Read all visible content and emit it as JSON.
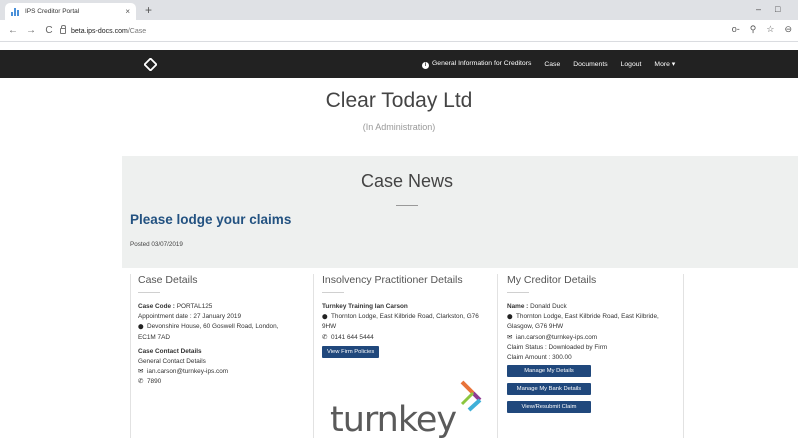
{
  "browser": {
    "tab_title": "IPS Creditor Portal",
    "tab_close": "×",
    "new_tab": "+",
    "url_host": "beta.ips-docs.com",
    "url_path": "/Case",
    "minimize": "–",
    "restore": "□",
    "back": "←",
    "forward": "→",
    "reload": "C",
    "key_icon": "o-",
    "zoom_icon": "⚲",
    "star_icon": "☆",
    "account_icon": "⊖"
  },
  "site_nav": {
    "info_label": "i",
    "general_info": "General Information for Creditors",
    "case": "Case",
    "documents": "Documents",
    "logout": "Logout",
    "more": "More ▾"
  },
  "hero": {
    "company": "Clear Today Ltd",
    "status": "(In Administration)"
  },
  "news": {
    "title": "Case News",
    "headline": "Please lodge your claims",
    "posted": "Posted 03/07/2019"
  },
  "case_details": {
    "title": "Case Details",
    "code_label": "Case Code :",
    "code_value": "PORTAL125",
    "appointment": "Appointment date : 27 January 2019",
    "address_line1": "Devonshire House, 60 Goswell Road, London,",
    "address_line2": "EC1M 7AD",
    "contact_heading": "Case Contact Details",
    "contact_general": "General Contact Details",
    "contact_email": "ian.carson@turnkey-ips.com",
    "contact_phone": "7890"
  },
  "ip_details": {
    "title": "Insolvency Practitioner Details",
    "name": "Turnkey Training Ian Carson",
    "address_line1": "Thornton Lodge, East Kilbride Road, Clarkston, G76",
    "address_line2": "9HW",
    "phone": "0141 644 5444",
    "button": "View Firm Policies",
    "logo_text": "turnkey"
  },
  "creditor_details": {
    "title": "My Creditor Details",
    "name_label": "Name :",
    "name_value": "Donald Duck",
    "address_line1": "Thornton Lodge, East Kilbride Road, East Kilbride,",
    "address_line2": "Glasgow, G76 9HW",
    "email": "ian.carson@turnkey-ips.com",
    "claim_status": "Claim Status : Downloaded by Firm",
    "claim_amount": "Claim Amount : 300.00",
    "btn_manage_details": "Manage My Details",
    "btn_manage_bank": "Manage My Bank Details",
    "btn_view_claim": "View/Resubmit Claim"
  },
  "icons": {
    "pin": "⬤",
    "phone": "✆",
    "mail": "✉"
  },
  "colors": {
    "nav_bg": "#222222",
    "headline": "#235281",
    "button": "#20487c",
    "news_bg": "#eef0ef"
  }
}
